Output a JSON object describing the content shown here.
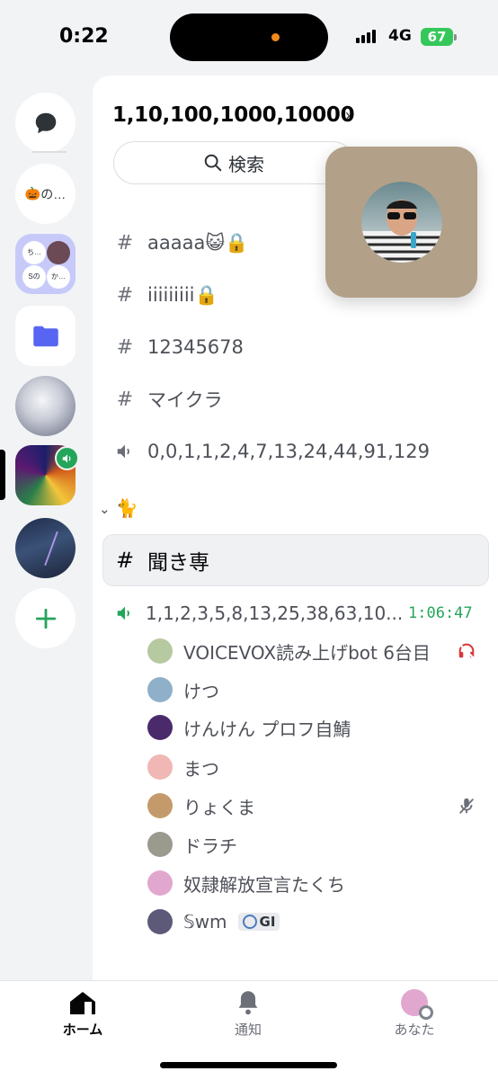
{
  "status_bar": {
    "time": "0:22",
    "network": "4G",
    "battery": "67"
  },
  "server_rail": {
    "folder_labels": [
      "ち…",
      "Sのサ…",
      "か…"
    ],
    "pumpkin_server": {
      "emoji": "🎃",
      "label": "の…"
    }
  },
  "server": {
    "name": "1,10,100,1000,10000"
  },
  "search": {
    "label": "検索"
  },
  "channels": [
    {
      "name": "aaaaa😺🔒",
      "type": "text-locked"
    },
    {
      "name": "iiiiiiiii🔒",
      "type": "text-locked"
    },
    {
      "name": "12345678",
      "type": "text-locked"
    },
    {
      "name": "マイクラ",
      "type": "text-locked"
    },
    {
      "name": "0,0,1,1,2,4,7,13,24,44,91,129",
      "type": "voice-locked"
    }
  ],
  "category": {
    "label": "🐈"
  },
  "selected_channel": {
    "name": "聞き専"
  },
  "voice_channel": {
    "name": "1,1,2,3,5,8,13,25,38,63,10...",
    "timer": "1:06:47",
    "members": [
      {
        "name": "VOICEVOX読み上げbot 6台目",
        "avatar_color": "#b6c9a1"
      },
      {
        "name": "けつ",
        "avatar_color": "#8fb0c9"
      },
      {
        "name": "けんけん プロフ自鯖",
        "avatar_color": "#4a2a6b"
      },
      {
        "name": "まつ",
        "avatar_color": "#f1b7b4"
      },
      {
        "name": "りょくま",
        "avatar_color": "#c49a6a"
      },
      {
        "name": "ドラチ",
        "avatar_color": "#9a9a8e"
      },
      {
        "name": "奴隷解放宣言たくち",
        "avatar_color": "#e2a7cf"
      },
      {
        "name": "𝕊wm",
        "avatar_color": "#5c5a78",
        "tag": "GI"
      }
    ]
  },
  "bottom_nav": {
    "home": "ホーム",
    "notifications": "通知",
    "you": "あなた"
  },
  "colors": {
    "accent_green": "#23a55a",
    "folder_blurple": "#5865f2",
    "deafen_red": "#da373c"
  }
}
